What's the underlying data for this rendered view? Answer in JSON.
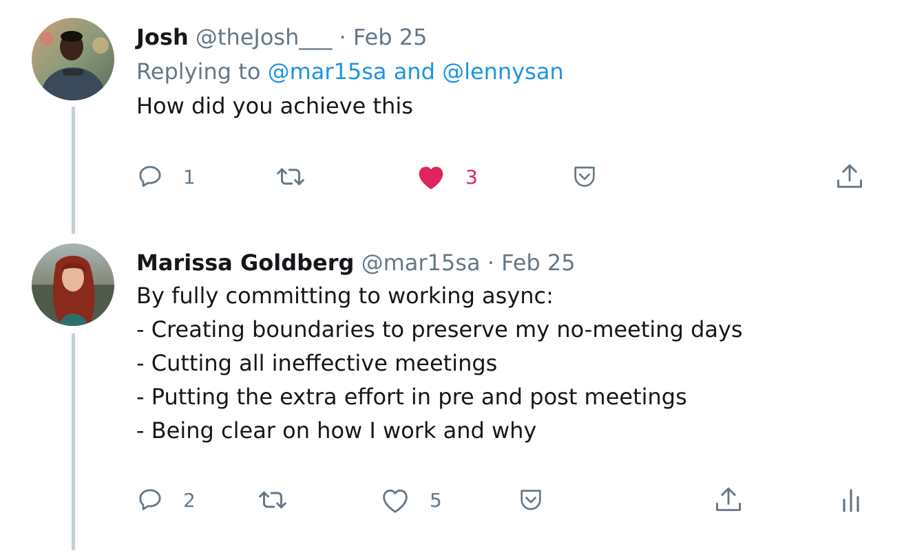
{
  "tweets": [
    {
      "name": "Josh",
      "handle": "@theJosh___",
      "separator": "·",
      "date": "Feb 25",
      "replying_prefix": "Replying to",
      "replying_to_1": "@mar15sa",
      "replying_and": "and",
      "replying_to_2": "@lennysan",
      "text": "How did you achieve this",
      "actions": {
        "replies": "1",
        "retweets": "",
        "likes": "3",
        "liked": true
      }
    },
    {
      "name": "Marissa Goldberg",
      "handle": "@mar15sa",
      "separator": "·",
      "date": "Feb 25",
      "text_lines": [
        "By fully committing to working async:",
        "- Creating boundaries to preserve my no-meeting days",
        "- Cutting all ineffective meetings",
        "- Putting the extra effort in pre and post meetings",
        "- Being clear on how I work and why"
      ],
      "actions": {
        "replies": "2",
        "retweets": "",
        "likes": "5",
        "liked": false
      }
    }
  ],
  "colors": {
    "muted": "#657786",
    "link": "#1b95e0",
    "like": "#e0245e",
    "thread_line": "#c4cfd6"
  },
  "icons": [
    "reply-icon",
    "retweet-icon",
    "like-icon",
    "bookmark-icon",
    "share-icon",
    "analytics-icon"
  ]
}
